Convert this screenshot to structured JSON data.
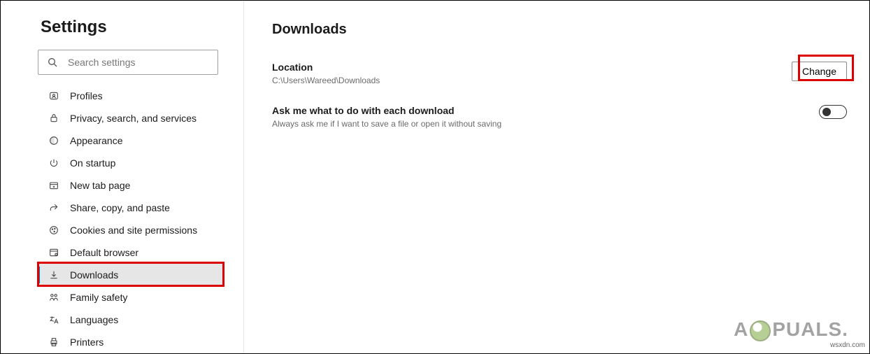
{
  "sidebar": {
    "title": "Settings",
    "search_placeholder": "Search settings",
    "items": [
      {
        "label": "Profiles"
      },
      {
        "label": "Privacy, search, and services"
      },
      {
        "label": "Appearance"
      },
      {
        "label": "On startup"
      },
      {
        "label": "New tab page"
      },
      {
        "label": "Share, copy, and paste"
      },
      {
        "label": "Cookies and site permissions"
      },
      {
        "label": "Default browser"
      },
      {
        "label": "Downloads",
        "selected": true
      },
      {
        "label": "Family safety"
      },
      {
        "label": "Languages"
      },
      {
        "label": "Printers"
      }
    ]
  },
  "main": {
    "heading": "Downloads",
    "location": {
      "title": "Location",
      "path": "C:\\Users\\Wareed\\Downloads",
      "button": "Change"
    },
    "ask": {
      "title": "Ask me what to do with each download",
      "sub": "Always ask me if I want to save a file or open it without saving",
      "toggle_on": false
    }
  },
  "watermark": "wsxdn.com",
  "brand": {
    "pre": "A",
    "post": "PUALS."
  }
}
